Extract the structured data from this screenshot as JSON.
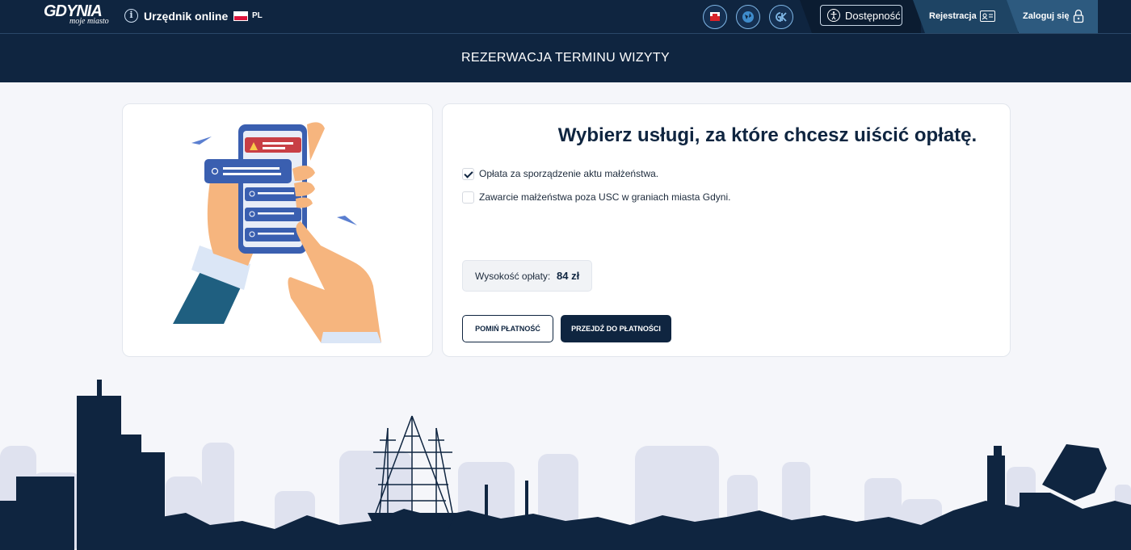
{
  "topbar": {
    "logo_main": "GDYNIA",
    "logo_sub": "moje miasto",
    "info_label": "Urzędnik online",
    "language": "PL",
    "accessibility_label": "Dostępność",
    "register_label": "Rejestracja",
    "login_label": "Zaloguj się"
  },
  "titlebar": {
    "title": "REZERWACJA TERMINU WIZYTY"
  },
  "panel": {
    "heading": "Wybierz usługi, za które chcesz uiścić opłatę.",
    "services": [
      {
        "label": "Opłata za sporządzenie aktu małżeństwa.",
        "checked": true
      },
      {
        "label": "Zawarcie małżeństwa poza USC w graniach miasta Gdyni.",
        "checked": false
      }
    ],
    "fee_label": "Wysokość opłaty:",
    "fee_value": "84 zł",
    "skip_button": "POMIŃ PŁATNOŚĆ",
    "pay_button": "PRZEJDŹ DO PŁATNOŚCI"
  },
  "colors": {
    "navy": "#0f2540",
    "page_bg": "#f5f6fa",
    "skyline_light": "#dfe2ef",
    "accent_blue": "#5b7fd0"
  }
}
